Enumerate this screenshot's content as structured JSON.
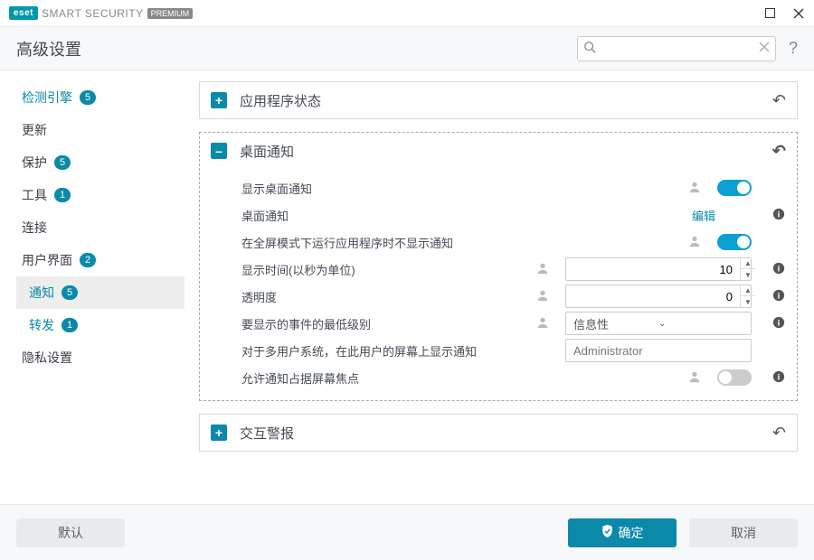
{
  "titlebar": {
    "brand_eset": "eset",
    "brand_text": "SMART SECURITY",
    "brand_premium": "PREMIUM"
  },
  "header": {
    "title": "高级设置",
    "search_placeholder": "",
    "help": "?"
  },
  "sidebar": {
    "items": [
      {
        "label": "检测引擎",
        "badge": "5",
        "link": true
      },
      {
        "label": "更新"
      },
      {
        "label": "保护",
        "badge": "5"
      },
      {
        "label": "工具",
        "badge": "1"
      },
      {
        "label": "连接"
      },
      {
        "label": "用户界面",
        "badge": "2"
      }
    ],
    "sub": [
      {
        "label": "通知",
        "badge": "5",
        "active": true
      },
      {
        "label": "转发",
        "badge": "1"
      }
    ],
    "last": {
      "label": "隐私设置"
    }
  },
  "panels": {
    "app_status": {
      "title": "应用程序状态"
    },
    "desktop": {
      "title": "桌面通知",
      "rows": {
        "show_notif": "显示桌面通知",
        "desktop_notif": "桌面通知",
        "edit": "编辑",
        "fullscreen_hide": "在全屏模式下运行应用程序时不显示通知",
        "display_time": "显示时间(以秒为单位)",
        "display_time_val": "10",
        "transparency": "透明度",
        "transparency_val": "0",
        "min_level": "要显示的事件的最低级别",
        "min_level_val": "信息性",
        "multiuser": "对于多用户系统，在此用户的屏幕上显示通知",
        "multiuser_val": "Administrator",
        "allow_focus": "允许通知占据屏幕焦点"
      }
    },
    "interactive": {
      "title": "交互警报"
    }
  },
  "footer": {
    "default": "默认",
    "ok": "确定",
    "cancel": "取消"
  }
}
